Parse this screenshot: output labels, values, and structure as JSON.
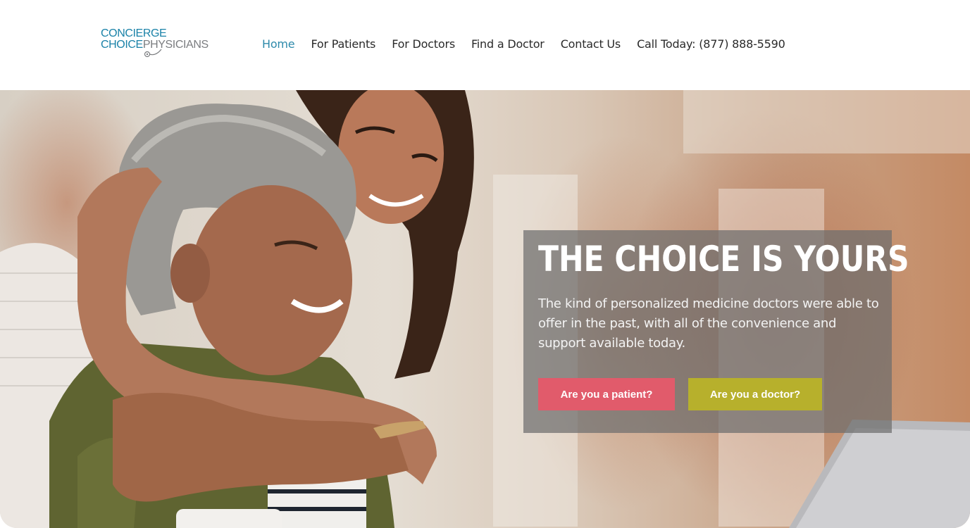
{
  "logo": {
    "line1": "CONCIERGE",
    "line2_choice": "CHOICE",
    "line2_physicians": "PHYSICIANS"
  },
  "nav": {
    "items": [
      {
        "label": "Home",
        "active": true
      },
      {
        "label": "For Patients",
        "active": false
      },
      {
        "label": "For Doctors",
        "active": false
      },
      {
        "label": "Find a Doctor",
        "active": false
      },
      {
        "label": "Contact Us",
        "active": false
      },
      {
        "label": "Call Today: (877) 888-5590",
        "active": false
      }
    ]
  },
  "hero": {
    "headline": "THE CHOICE IS YOURS",
    "subtext": "The kind of personalized medicine doctors were able to offer in the past, with all of the convenience and support available today.",
    "patient_button": "Are you a patient?",
    "doctor_button": "Are you a doctor?"
  },
  "colors": {
    "brand_blue": "#1a82a8",
    "nav_active": "#2e8aab",
    "patient_button": "#e15b6b",
    "doctor_button": "#b7b02c"
  }
}
